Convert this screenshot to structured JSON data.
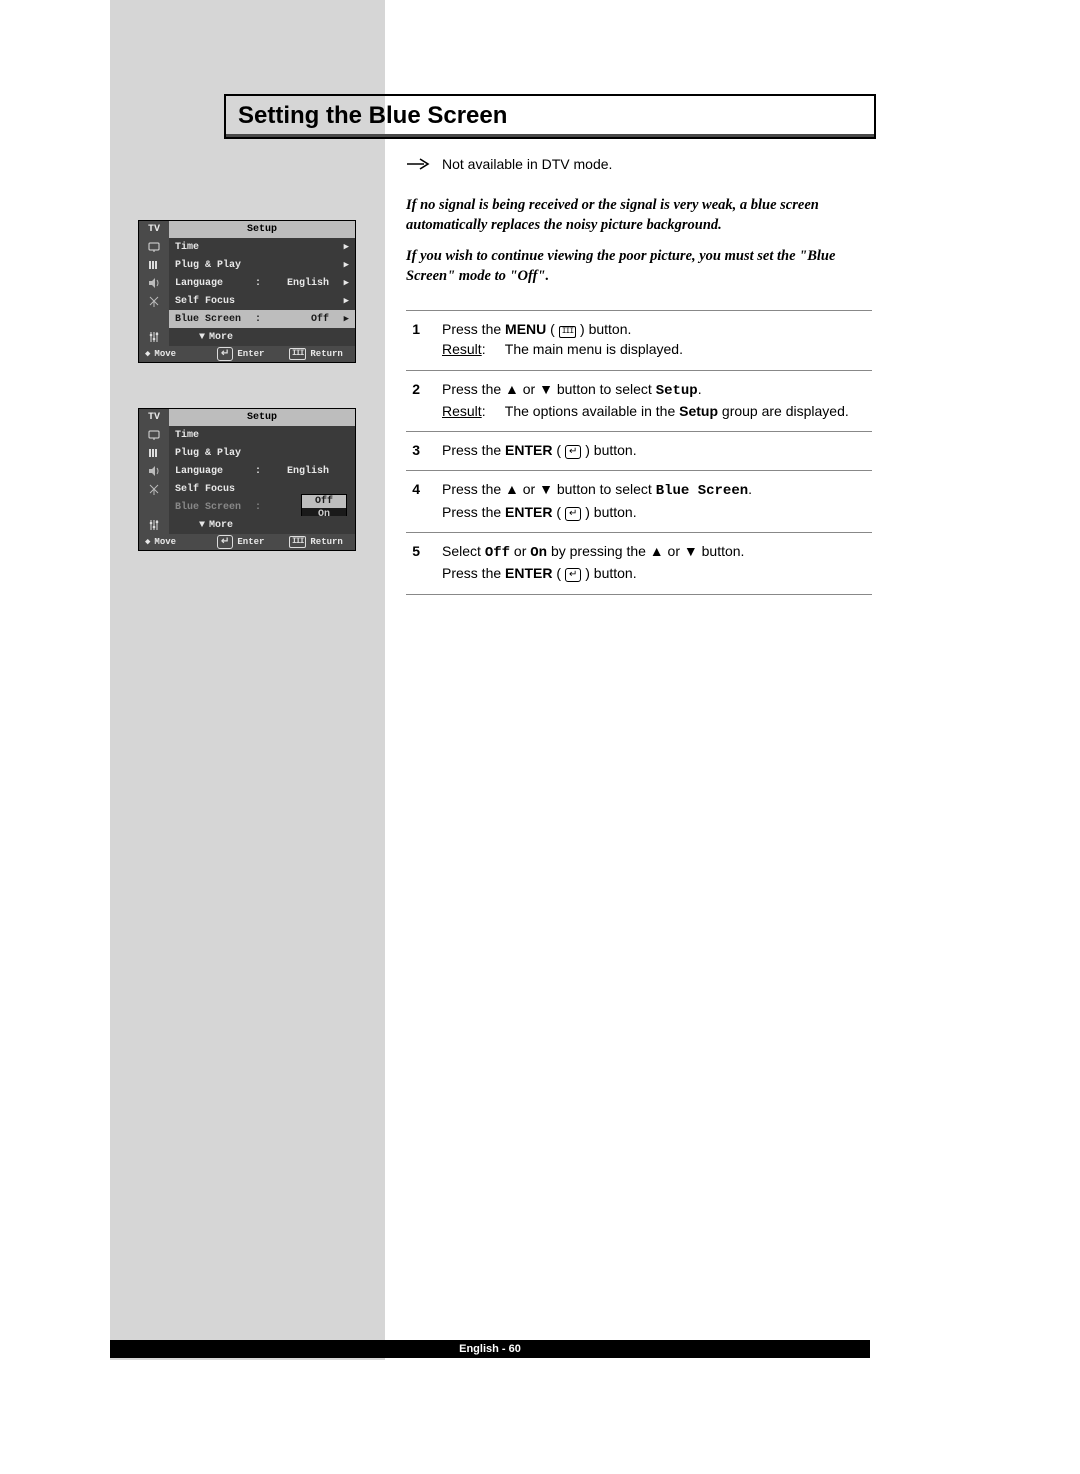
{
  "title": "Setting the Blue Screen",
  "note": "Not available in DTV mode.",
  "intro_p1": "If no signal is being received or the signal is very weak, a blue screen automatically replaces the noisy picture background.",
  "intro_p2": "If you wish to continue viewing the poor picture, you must set the \"Blue Screen\" mode to \"Off\".",
  "steps": [
    {
      "num": "1",
      "line1_pre": "Press the ",
      "line1_bold": "MENU",
      "line1_post": " button.",
      "result_label": "Result",
      "result_text": "The main menu is displayed."
    },
    {
      "num": "2",
      "line1_pre": "Press the ▲ or ▼ button to select ",
      "line1_mono": "Setup",
      "line1_post": ".",
      "result_label": "Result",
      "result_text_pre": "The options available in the ",
      "result_text_bold": "Setup",
      "result_text_post": " group are displayed."
    },
    {
      "num": "3",
      "line1_pre": "Press the ",
      "line1_bold": "ENTER",
      "line1_post": " button."
    },
    {
      "num": "4",
      "line1_pre": "Press the ▲ or ▼ button to select ",
      "line1_mono": "Blue Screen",
      "line1_post": ".",
      "line2_pre": "Press the ",
      "line2_bold": "ENTER",
      "line2_post": " button."
    },
    {
      "num": "5",
      "line1_pre": "Select ",
      "line1_mono1": "Off",
      "line1_mid": " or ",
      "line1_mono2": "On",
      "line1_post": " by pressing the ▲ or ▼ button.",
      "line2_pre": "Press the ",
      "line2_bold": "ENTER",
      "line2_post": " button."
    }
  ],
  "osd": {
    "tv": "TV",
    "setup": "Setup",
    "rows": {
      "time": "Time",
      "plug": "Plug & Play",
      "language": "Language",
      "language_val": "English",
      "self_focus": "Self Focus",
      "blue_screen": "Blue Screen",
      "blue_screen_val": "Off",
      "more": "More"
    },
    "foot": {
      "move": "Move",
      "enter": "Enter",
      "return": "Return"
    },
    "dropdown": {
      "off": "Off",
      "on": "On"
    }
  },
  "footer": "English - 60"
}
